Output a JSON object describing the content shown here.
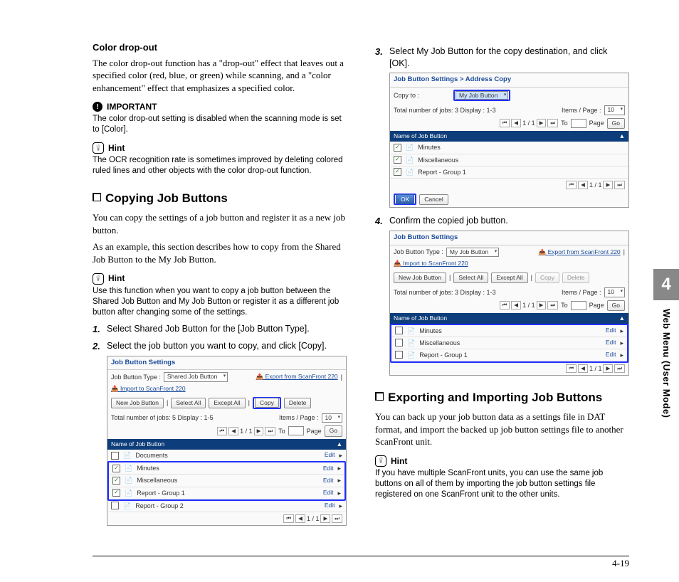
{
  "left": {
    "h_color": "Color drop-out",
    "p_color": "The color drop-out function has a \"drop-out\" effect that leaves out a specified color (red, blue, or green) while scanning, and a \"color enhancement\" effect that emphasizes a specified color.",
    "important_label": "IMPORTANT",
    "important_body": "The color drop-out setting is disabled when the scanning mode is set to [Color].",
    "hint1_label": "Hint",
    "hint1_body": "The OCR recognition rate is sometimes improved by deleting colored ruled lines and other objects with the color drop-out function.",
    "h_copy": "Copying Job Buttons",
    "p_copy1": "You can copy the settings of a job button and register it as a new job button.",
    "p_copy2": "As an example, this section describes how to copy from the Shared Job Button to the My Job Button.",
    "hint2_label": "Hint",
    "hint2_body": "Use this function when you want to copy a job button between the Shared Job Button and My Job Button or register it as a different job button after changing some of the settings.",
    "step1": "Select Shared Job Button for the [Job Button Type].",
    "step2": "Select the job button you want to copy, and click [Copy].",
    "ss1": {
      "title": "Job Button Settings",
      "type_label": "Job Button Type :",
      "type_value": "Shared Job Button",
      "export": "Export from ScanFront 220",
      "import": "Import to ScanFront 220",
      "new": "New Job Button",
      "selectall": "Select All",
      "exceptall": "Except All",
      "copy": "Copy",
      "delete": "Delete",
      "total": "Total number of jobs: 5  Display : 1-5",
      "items": "Items / Page :",
      "items_val": "10",
      "to": "To",
      "page": "Page",
      "go": "Go",
      "pager": "1 / 1",
      "th": "Name of Job Button",
      "rows": [
        "Documents",
        "Minutes",
        "Miscellaneous",
        "Report - Group 1",
        "Report - Group 2"
      ],
      "edit": "Edit"
    }
  },
  "right": {
    "step3": "Select My Job Button for the copy destination, and click [OK].",
    "ss2": {
      "title": "Job Button Settings > Address Copy",
      "copyto": "Copy to :",
      "copyto_val": "My Job Button",
      "total": "Total number of jobs: 3  Display : 1-3",
      "items": "Items / Page :",
      "items_val": "10",
      "to": "To",
      "page": "Page",
      "go": "Go",
      "pager": "1 / 1",
      "th": "Name of Job Button",
      "rows": [
        "Minutes",
        "Miscellaneous",
        "Report - Group 1"
      ],
      "ok": "OK",
      "cancel": "Cancel"
    },
    "step4": "Confirm the copied job button.",
    "ss3": {
      "title": "Job Button Settings",
      "type_label": "Job Button Type :",
      "type_value": "My Job Button",
      "export": "Export from ScanFront 220",
      "import": "Import to ScanFront 220",
      "new": "New Job Button",
      "selectall": "Select All",
      "exceptall": "Except All",
      "copy": "Copy",
      "delete": "Delete",
      "total": "Total number of jobs: 3  Display : 1-3",
      "items": "Items / Page :",
      "items_val": "10",
      "to": "To",
      "page": "Page",
      "go": "Go",
      "pager": "1 / 1",
      "th": "Name of Job Button",
      "rows": [
        "Minutes",
        "Miscellaneous",
        "Report - Group 1"
      ],
      "edit": "Edit"
    },
    "h_export": "Exporting and Importing Job Buttons",
    "p_export": "You can back up your job button data as a settings file in DAT format, and import the backed up job button settings file to another ScanFront unit.",
    "hint_label": "Hint",
    "hint_body": "If you have multiple ScanFront units, you can use the same job buttons on all of them by importing the job button settings file registered on one ScanFront unit to the other units."
  },
  "side": {
    "chapter": "4",
    "label": "Web Menu (User Mode)"
  },
  "footer": "4-19"
}
